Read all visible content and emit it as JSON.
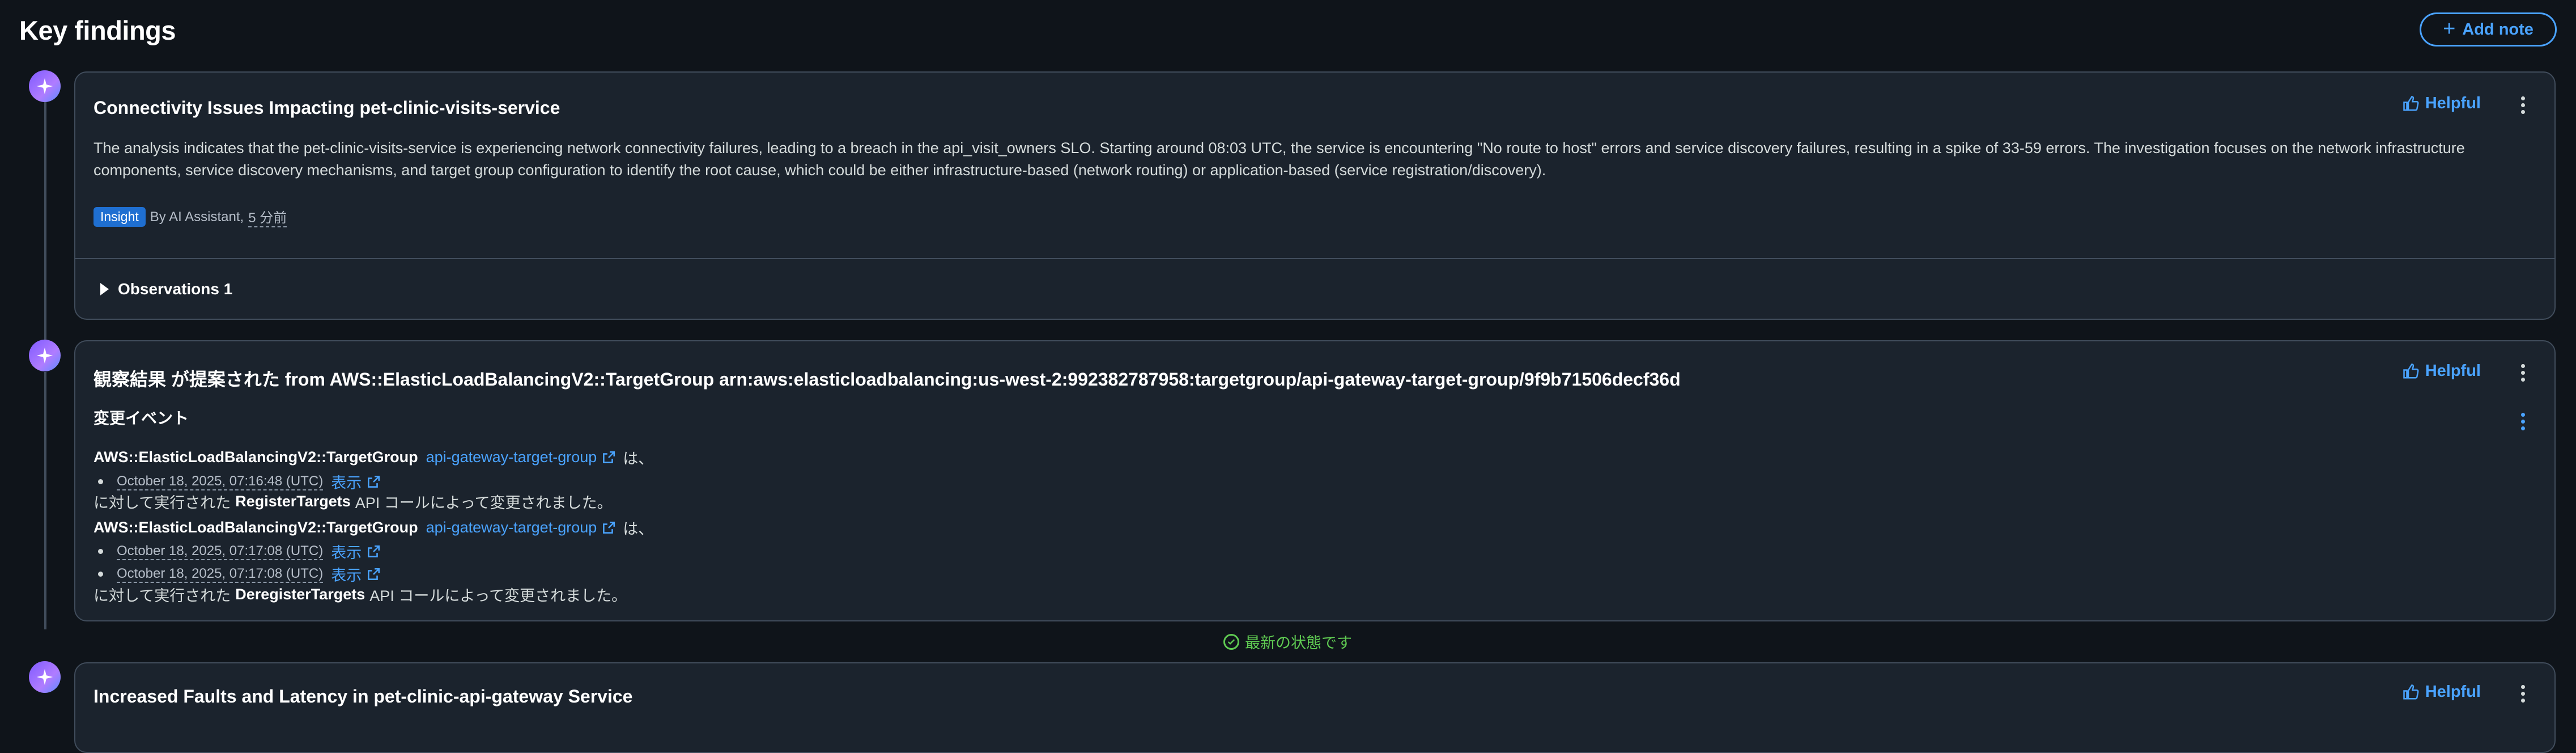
{
  "page": {
    "title": "Key findings",
    "add_note_label": "Add note"
  },
  "cards": [
    {
      "title": "Connectivity Issues Impacting pet-clinic-visits-service",
      "helpful_label": "Helpful",
      "summary": "The analysis indicates that the pet-clinic-visits-service is experiencing network connectivity failures, leading to a breach in the api_visit_owners SLO. Starting around 08:03 UTC, the service is encountering \"No route to host\" errors and service discovery failures, resulting in a spike of 33-59 errors. The investigation focuses on the network infrastructure components, service discovery mechanisms, and target group configuration to identify the root cause, which could be either infrastructure-based (network routing) or application-based (service registration/discovery).",
      "badge": "Insight",
      "author": "By AI Assistant,",
      "time": "5 分前",
      "observations_label": "Observations 1"
    },
    {
      "title": "観察結果 が提案された from AWS::ElasticLoadBalancingV2::TargetGroup arn:aws:elasticloadbalancing:us-west-2:992382787958:targetgroup/api-gateway-target-group/9f9b71506decf36d",
      "helpful_label": "Helpful",
      "section_label": "変更イベント",
      "resource_type": "AWS::ElasticLoadBalancingV2::TargetGroup",
      "resource_link": "api-gateway-target-group",
      "suffix_ha": "は、",
      "event1": {
        "timestamps": [
          "October 18, 2025, 07:16:48 (UTC)"
        ],
        "show_label": "表示",
        "pre": "に対して実行された",
        "api": "RegisterTargets",
        "post": "API コールによって変更されました。"
      },
      "event2": {
        "timestamps": [
          "October 18, 2025, 07:17:08 (UTC)",
          "October 18, 2025, 07:17:08 (UTC)"
        ],
        "show_label": "表示",
        "pre": "に対して実行された",
        "api": "DeregisterTargets",
        "post": "API コールによって変更されました。"
      }
    },
    {
      "title": "Increased Faults and Latency in pet-clinic-api-gateway Service",
      "helpful_label": "Helpful"
    }
  ],
  "status_text": "最新の状態です",
  "colors": {
    "accent": "#4aa3ff",
    "success": "#5fca52",
    "badge": "#1f6fd1",
    "card_bg": "#1b232d",
    "page_bg": "#0f141a"
  },
  "icons": [
    "sparkle-icon",
    "plus-icon",
    "thumbs-up-icon",
    "more-vertical-icon",
    "caret-right-icon",
    "external-link-icon",
    "check-circle-icon"
  ]
}
